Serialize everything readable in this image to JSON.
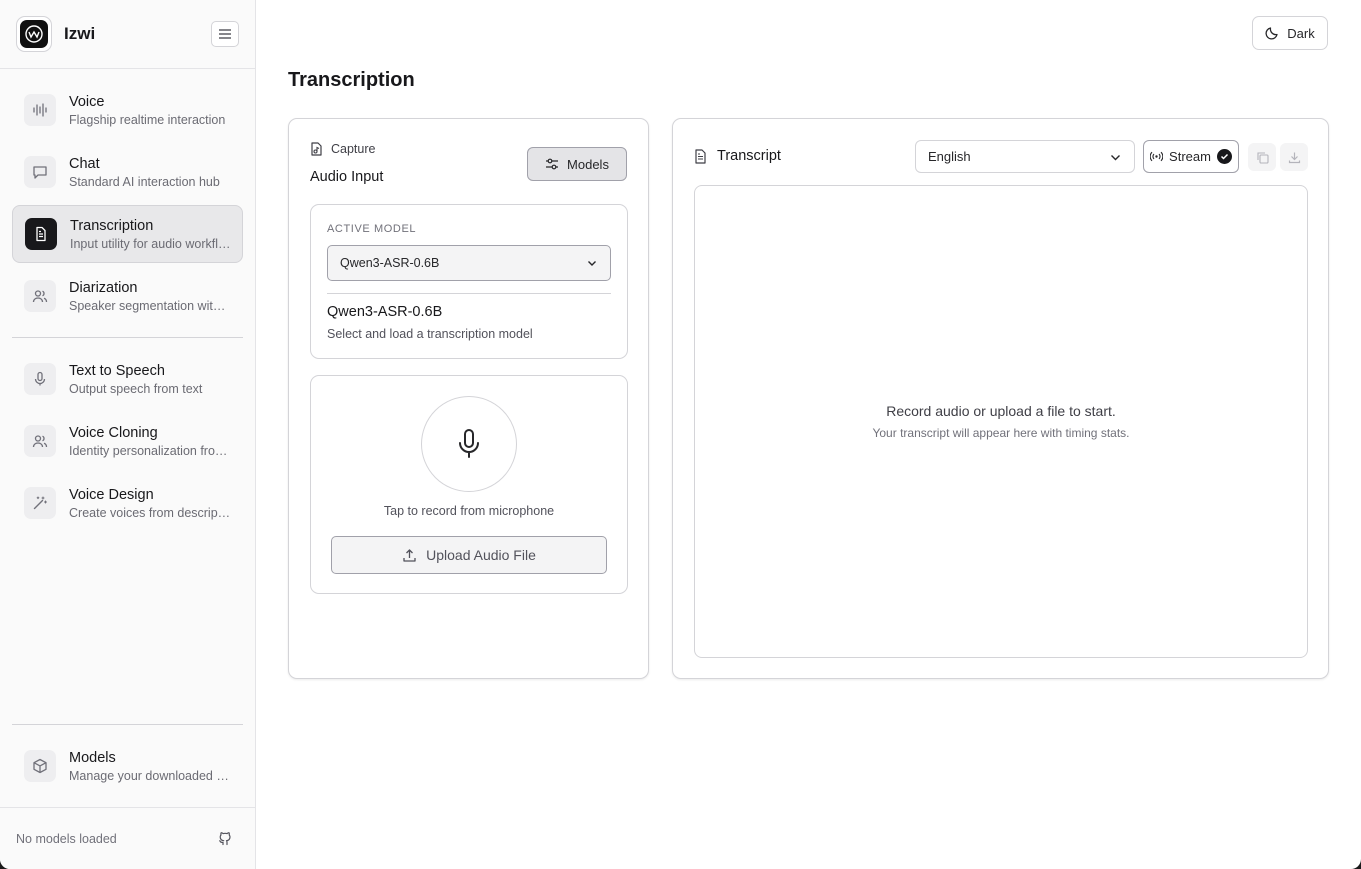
{
  "app": {
    "name": "Izwi"
  },
  "sidebar": {
    "items": [
      {
        "title": "Voice",
        "subtitle": "Flagship realtime interaction",
        "icon": "waveform-icon"
      },
      {
        "title": "Chat",
        "subtitle": "Standard AI interaction hub",
        "icon": "chat-icon"
      },
      {
        "title": "Transcription",
        "subtitle": "Input utility for audio workflows",
        "icon": "document-icon",
        "active": true
      },
      {
        "title": "Diarization",
        "subtitle": "Speaker segmentation with timestamps",
        "icon": "users-icon"
      },
      {
        "title": "Text to Speech",
        "subtitle": "Output speech from text",
        "icon": "mic-icon"
      },
      {
        "title": "Voice Cloning",
        "subtitle": "Identity personalization from samples",
        "icon": "users-icon"
      },
      {
        "title": "Voice Design",
        "subtitle": "Create voices from descriptions",
        "icon": "magic-wand-icon"
      }
    ],
    "models": {
      "title": "Models",
      "subtitle": "Manage your downloaded models",
      "icon": "cube-icon"
    },
    "footer_status": "No models loaded"
  },
  "header": {
    "theme_label": "Dark"
  },
  "page": {
    "title": "Transcription"
  },
  "capture": {
    "label": "Capture",
    "title": "Audio Input",
    "models_button": "Models",
    "active_model_label": "ACTIVE MODEL",
    "selected_model": "Qwen3-ASR-0.6B",
    "model_name": "Qwen3-ASR-0.6B",
    "model_hint": "Select and load a transcription model",
    "tap_text": "Tap to record from microphone",
    "upload_label": "Upload Audio File"
  },
  "transcript": {
    "title": "Transcript",
    "language": "English",
    "stream_label": "Stream",
    "empty_title": "Record audio or upload a file to start.",
    "empty_subtitle": "Your transcript will appear here with timing stats."
  },
  "colors": {
    "accent": "#18181b",
    "active_bg": "#e8e8ea",
    "border": "#d4d4d8"
  }
}
